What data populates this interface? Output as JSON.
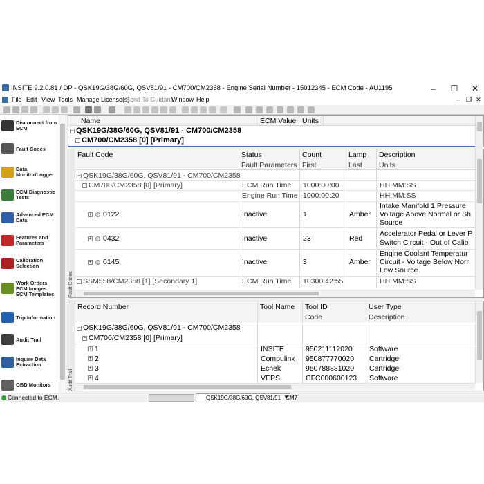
{
  "window": {
    "title": "INSITE 9.2.0.81  /  DP  -  QSK19G/38G/60G, QSV81/91  -  CM700/CM2358  -  Engine Serial Number  -  15012345  -  ECM Code  -  AU1195",
    "minimize": "–",
    "maximize": "☐",
    "close": "✕",
    "mdi_min": "–",
    "mdi_restore": "❐",
    "mdi_close": "✕"
  },
  "menu": [
    "File",
    "Edit",
    "View",
    "Tools",
    "Manage License(s)",
    "Send To Guidanz",
    "Window",
    "Help"
  ],
  "nav": [
    {
      "label": "Disconnect from\nECM",
      "icon": "disconnect-icon",
      "color": "#333333"
    },
    {
      "label": "Fault Codes",
      "icon": "fault-codes-icon",
      "color": "#555555"
    },
    {
      "label": "Data\nMonitor/Logger",
      "icon": "data-monitor-icon",
      "color": "#d4a017"
    },
    {
      "label": "ECM Diagnostic\nTests",
      "icon": "diagnostic-tests-icon",
      "color": "#3a7d3a"
    },
    {
      "label": "Advanced ECM\nData",
      "icon": "advanced-ecm-data-icon",
      "color": "#2f5fa8"
    },
    {
      "label": "Features and\nParameters",
      "icon": "features-parameters-icon",
      "color": "#c0282a"
    },
    {
      "label": "Calibration\nSelection",
      "icon": "calibration-icon",
      "color": "#b02020"
    },
    {
      "label": "Work Orders\nECM Images\nECM Templates",
      "icon": "work-orders-icon",
      "color": "#6b8e23"
    },
    {
      "label": "Trip Information",
      "icon": "trip-information-icon",
      "color": "#2060b0"
    },
    {
      "label": "Audit Trail",
      "icon": "audit-trail-icon",
      "color": "#404040"
    },
    {
      "label": "Inquire Data\nExtraction",
      "icon": "inquire-data-icon",
      "color": "#3060a0"
    },
    {
      "label": "OBD Monitors",
      "icon": "obd-monitors-icon",
      "color": "#606060"
    }
  ],
  "top_grid": {
    "headers": [
      "Name",
      "ECM Value",
      "Units"
    ],
    "row1": "QSK19G/38G/60G, QSV81/91 - CM700/CM2358",
    "row2": "CM700/CM2358 [0] [Primary]"
  },
  "fault_grid": {
    "side_label": "Fault Codes",
    "headers1": [
      "Fault Code",
      "Status",
      "Count",
      "Lamp",
      "Description"
    ],
    "headers2": [
      "Fault Parameters",
      "First",
      "Last",
      "Units"
    ],
    "group": "QSK19G/38G/60G, QSV81/91 - CM700/CM2358",
    "subgroup": "CM700/CM2358 [0] [Primary]",
    "param_rows": [
      {
        "name": "ECM Run Time",
        "value": "1000:00:00",
        "units": "HH:MM:SS"
      },
      {
        "name": "Engine Run Time",
        "value": "1000:00:20",
        "units": "HH:MM:SS"
      }
    ],
    "faults": [
      {
        "code": "0122",
        "status": "Inactive",
        "count": "1",
        "lamp": "Amber",
        "desc": [
          "Intake Manifold 1 Pressure",
          "Voltage Above Normal or Sh",
          "Source"
        ]
      },
      {
        "code": "0432",
        "status": "Inactive",
        "count": "23",
        "lamp": "Red",
        "desc": [
          "Accelerator Pedal or Lever P",
          "Switch Circuit - Out of Calib"
        ]
      },
      {
        "code": "0145",
        "status": "Inactive",
        "count": "3",
        "lamp": "Amber",
        "desc": [
          "Engine Coolant Temperatur",
          "Circuit - Voltage Below Norr",
          "Low Source"
        ]
      }
    ],
    "secondary": {
      "name": "SSM558/CM2358 [1] [Secondary 1]",
      "param": "ECM Run Time",
      "value": "10300:42:55",
      "units": "HH:MM:SS"
    }
  },
  "audit_grid": {
    "side_label": "Audit Trail",
    "headers1": [
      "Record Number",
      "Tool Name",
      "Tool ID",
      "User Type"
    ],
    "headers2": [
      "Code",
      "Description"
    ],
    "group": "QSK19G/38G/60G, QSV81/91 - CM700/CM2358",
    "subgroup": "CM700/CM2358 [0] [Primary]",
    "rows": [
      {
        "num": "1",
        "tool": "INSITE",
        "id": "950211112020",
        "type": "Software"
      },
      {
        "num": "2",
        "tool": "Compulink",
        "id": "950877770020",
        "type": "Cartridge"
      },
      {
        "num": "3",
        "tool": "Echek",
        "id": "950788881020",
        "type": "Cartridge"
      },
      {
        "num": "4",
        "tool": "VEPS",
        "id": "CFC000600123",
        "type": "Software"
      }
    ]
  },
  "status": {
    "connected": "Connected to ECM.",
    "dropdown": "QSK19G/38G/60G, QSV81/91 - CM7"
  }
}
